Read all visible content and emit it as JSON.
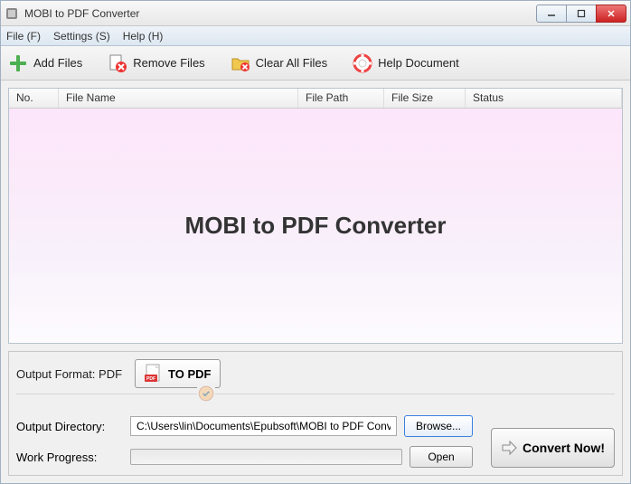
{
  "window": {
    "title": "MOBI to PDF Converter"
  },
  "menubar": {
    "file": "File (F)",
    "settings": "Settings (S)",
    "help": "Help (H)"
  },
  "toolbar": {
    "add_files": "Add Files",
    "remove_files": "Remove Files",
    "clear_all": "Clear All Files",
    "help_doc": "Help Document"
  },
  "columns": {
    "no": "No.",
    "name": "File Name",
    "path": "File Path",
    "size": "File Size",
    "status": "Status"
  },
  "watermark": "MOBI to PDF Converter",
  "output": {
    "format_label": "Output Format: PDF",
    "topdf_label": "TO PDF",
    "dir_label": "Output Directory:",
    "dir_value": "C:\\Users\\lin\\Documents\\Epubsoft\\MOBI to PDF Converter\\t",
    "browse": "Browse...",
    "open": "Open"
  },
  "progress": {
    "label": "Work Progress:"
  },
  "convert": {
    "label": "Convert Now!"
  }
}
